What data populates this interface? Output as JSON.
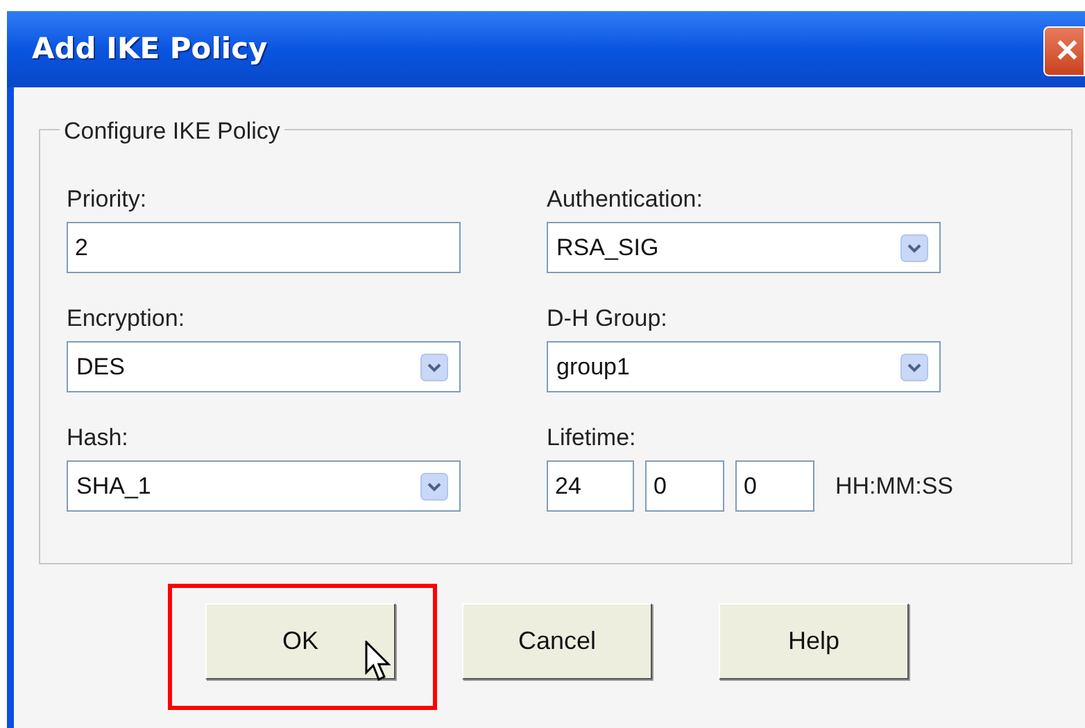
{
  "window": {
    "title": "Add IKE Policy",
    "close": "✕"
  },
  "group": {
    "legend": "Configure IKE Policy",
    "rows": [
      {
        "left": {
          "kind": "text",
          "label": "Priority:",
          "value": "2"
        },
        "right": {
          "kind": "select",
          "label": "Authentication:",
          "value": "RSA_SIG"
        }
      },
      {
        "left": {
          "kind": "select",
          "label": "Encryption:",
          "value": "DES"
        },
        "right": {
          "kind": "select",
          "label": "D-H Group:",
          "value": "group1"
        }
      },
      {
        "left": {
          "kind": "select",
          "label": "Hash:",
          "value": "SHA_1"
        },
        "right": {
          "kind": "time",
          "label": "Lifetime:",
          "values": [
            "24",
            "0",
            "0"
          ],
          "format": "HH:MM:SS"
        }
      }
    ]
  },
  "buttons": [
    {
      "label": "OK",
      "highlighted": true,
      "pointer": true
    },
    {
      "label": "Cancel",
      "highlighted": false,
      "pointer": false
    },
    {
      "label": "Help",
      "highlighted": false,
      "pointer": false
    }
  ]
}
